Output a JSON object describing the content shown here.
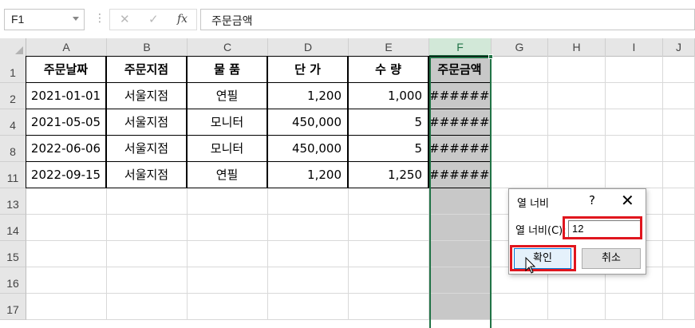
{
  "formula_bar": {
    "name_box": "F1",
    "divider": "⋮",
    "cancel_icon": "✕",
    "enter_icon": "✓",
    "fx_label": "fx",
    "formula": "주문금액"
  },
  "columns": [
    "A",
    "B",
    "C",
    "D",
    "E",
    "F",
    "G",
    "H",
    "I",
    "J"
  ],
  "rows": [
    {
      "row": "1",
      "cells": [
        "주문날짜",
        "주문지점",
        "물 품",
        "단 가",
        "수 량",
        "주문금액"
      ]
    },
    {
      "row": "2",
      "cells": [
        "2021-01-01",
        "서울지점",
        "연필",
        "1,200",
        "1,000",
        "#######"
      ]
    },
    {
      "row": "4",
      "cells": [
        "2021-05-05",
        "서울지점",
        "모니터",
        "450,000",
        "5",
        "#######"
      ]
    },
    {
      "row": "8",
      "cells": [
        "2022-06-06",
        "서울지점",
        "모니터",
        "450,000",
        "5",
        "#######"
      ]
    },
    {
      "row": "11",
      "cells": [
        "2022-09-15",
        "서울지점",
        "연필",
        "1,200",
        "1,250",
        "#######"
      ]
    },
    {
      "row": "13",
      "cells": []
    },
    {
      "row": "14",
      "cells": []
    },
    {
      "row": "15",
      "cells": []
    },
    {
      "row": "16",
      "cells": []
    },
    {
      "row": "17",
      "cells": []
    }
  ],
  "dialog": {
    "title": "열 너비",
    "help": "?",
    "close": "✕",
    "label": "열 너비(C):",
    "value": "12",
    "ok": "확인",
    "cancel": "취소"
  },
  "colors": {
    "accent": "#217346",
    "highlight": "#e0161e",
    "selected_column": "#c8c8c8"
  }
}
